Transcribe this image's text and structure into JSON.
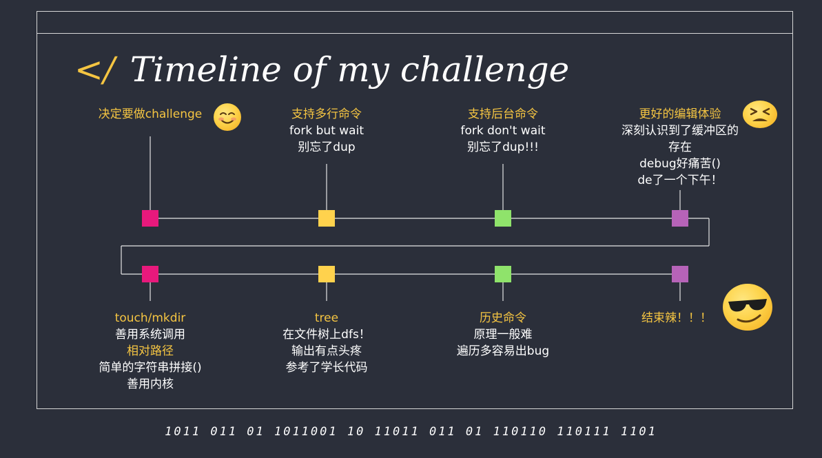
{
  "title": {
    "icon_text": "</",
    "text": "Timeline of my challenge"
  },
  "colors": {
    "pink": "#e8197c",
    "yellow": "#ffd24d",
    "green": "#8fe36b",
    "purple": "#b663b8",
    "label_yellow": "#f5c542",
    "line": "#e6e6e6"
  },
  "top_events": [
    {
      "lines": [
        "决定要做challenge"
      ],
      "styles": [
        "yellow"
      ],
      "emoji": "smiling-face-icon"
    },
    {
      "lines": [
        "支持多行命令",
        "fork but wait",
        "别忘了dup"
      ],
      "styles": [
        "yellow",
        "white",
        "white"
      ]
    },
    {
      "lines": [
        "支持后台命令",
        "fork don't wait",
        "别忘了dup!!!"
      ],
      "styles": [
        "yellow",
        "white",
        "white"
      ]
    },
    {
      "lines": [
        "更好的编辑体验",
        "深刻认识到了缓冲区的",
        "存在",
        "debug好痛苦()",
        "de了一个下午！"
      ],
      "styles": [
        "yellow",
        "white",
        "white",
        "white",
        "white"
      ],
      "emoji": "tired-face-icon"
    }
  ],
  "bottom_events": [
    {
      "lines": [
        "touch/mkdir",
        "善用系统调用",
        "相对路径",
        "简单的字符串拼接()",
        "善用内核"
      ],
      "styles": [
        "yellow",
        "white",
        "yellow",
        "white",
        "white"
      ]
    },
    {
      "lines": [
        "tree",
        "在文件树上dfs！",
        "输出有点头疼",
        "参考了学长代码"
      ],
      "styles": [
        "yellow",
        "white",
        "white",
        "white"
      ]
    },
    {
      "lines": [
        "历史命令",
        "原理一般难",
        "遍历多容易出bug"
      ],
      "styles": [
        "yellow",
        "white",
        "white"
      ]
    },
    {
      "lines": [
        "结束辣！！！"
      ],
      "styles": [
        "yellow"
      ],
      "emoji": "sunglasses-face-icon"
    }
  ],
  "binary_footer": "1011 011 01 1011001 10 11011 011 01 110110 110111 1101"
}
